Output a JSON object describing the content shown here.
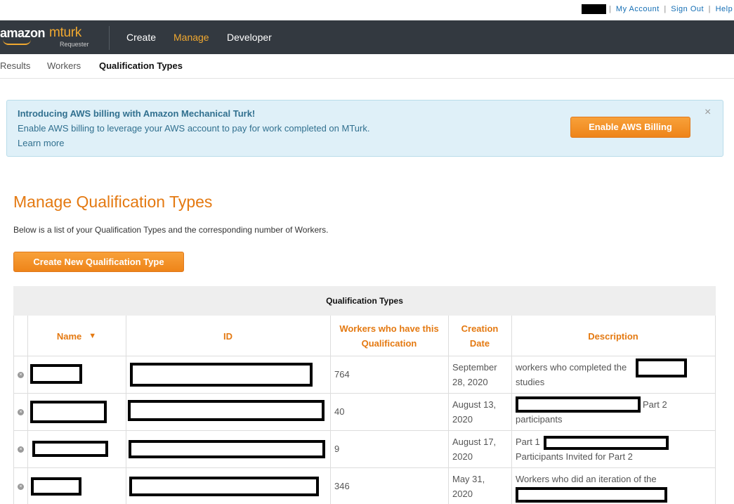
{
  "topbar": {
    "links": [
      "My Account",
      "Sign Out",
      "Help"
    ]
  },
  "navbar": {
    "logo_amazon": "amazon",
    "logo_mturk": "mturk",
    "logo_requester": "Requester",
    "items": [
      "Create",
      "Manage",
      "Developer"
    ],
    "active": "Manage"
  },
  "subnav": {
    "items": [
      "Results",
      "Workers",
      "Qualification Types"
    ],
    "active": "Qualification Types"
  },
  "banner": {
    "title": "Introducing AWS billing with Amazon Mechanical Turk!",
    "text": "Enable AWS billing to leverage your AWS account to pay for work completed on MTurk.",
    "link": "Learn more",
    "button": "Enable AWS Billing",
    "close": "×"
  },
  "page": {
    "title": "Manage Qualification Types",
    "description": "Below is a list of your Qualification Types and the corresponding number of Workers.",
    "create_button": "Create New Qualification Type"
  },
  "table": {
    "caption": "Qualification Types",
    "headers": {
      "name": "Name",
      "sort_icon": "▼",
      "id": "ID",
      "workers_line1": "Workers who have this",
      "workers_line2": "Qualification",
      "date_line1": "Creation",
      "date_line2": "Date",
      "description": "Description"
    },
    "rows": [
      {
        "workers": "764",
        "date_line1": "September",
        "date_line2": "28, 2020",
        "desc_line1": "workers who completed the",
        "desc_line2": "studies"
      },
      {
        "workers": "40",
        "date_line1": "August 13,",
        "date_line2": "2020",
        "desc_line1": "Part 2",
        "desc_line2": "participants"
      },
      {
        "workers": "9",
        "date_line1": "August 17,",
        "date_line2": "2020",
        "desc_line1": "Part 1",
        "desc_line2": "Participants Invited for Part 2"
      },
      {
        "workers": "346",
        "date_line1": "May 31,",
        "date_line2": "2020",
        "desc_line1": "Workers who did an iteration of the",
        "desc_line2": ""
      }
    ]
  },
  "colors": {
    "accent_orange": "#e47911",
    "nav_dark": "#333940",
    "banner_bg": "#dff0f8",
    "link_blue": "#146eb4"
  }
}
